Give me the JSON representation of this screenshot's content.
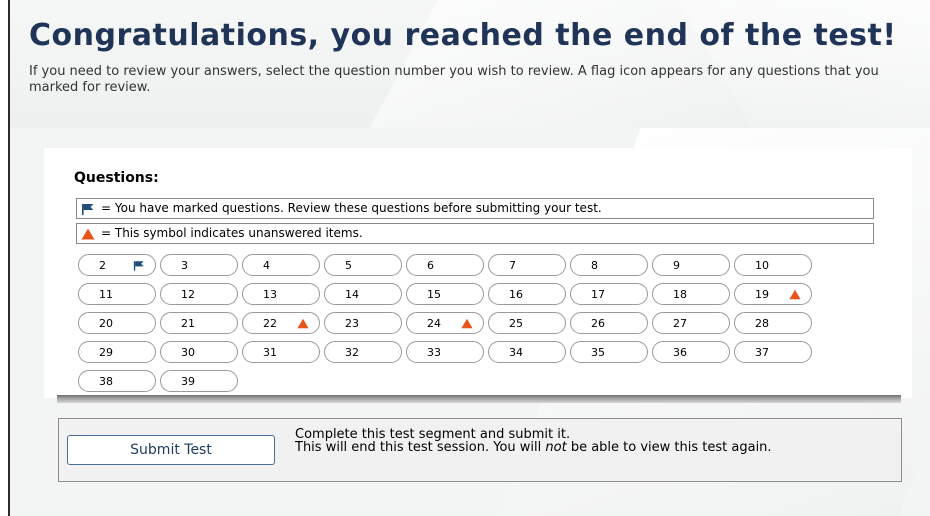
{
  "header": {
    "title": "Congratulations, you reached the end of the test!",
    "subtitle": "If you need to review your answers, select the question number you wish to review. A flag icon appears for any questions that you marked for review."
  },
  "panel": {
    "heading": "Questions:",
    "legend": {
      "flag_icon": "flag-icon",
      "flag_text": "= You have marked questions. Review these questions before submitting your test.",
      "unanswered_icon": "warning-triangle-icon",
      "unanswered_text": "= This symbol indicates unanswered items."
    }
  },
  "questions": [
    {
      "num": "2",
      "marked": true,
      "unanswered": false
    },
    {
      "num": "3",
      "marked": false,
      "unanswered": false
    },
    {
      "num": "4",
      "marked": false,
      "unanswered": false
    },
    {
      "num": "5",
      "marked": false,
      "unanswered": false
    },
    {
      "num": "6",
      "marked": false,
      "unanswered": false
    },
    {
      "num": "7",
      "marked": false,
      "unanswered": false
    },
    {
      "num": "8",
      "marked": false,
      "unanswered": false
    },
    {
      "num": "9",
      "marked": false,
      "unanswered": false
    },
    {
      "num": "10",
      "marked": false,
      "unanswered": false
    },
    {
      "num": "11",
      "marked": false,
      "unanswered": false
    },
    {
      "num": "12",
      "marked": false,
      "unanswered": false
    },
    {
      "num": "13",
      "marked": false,
      "unanswered": false
    },
    {
      "num": "14",
      "marked": false,
      "unanswered": false
    },
    {
      "num": "15",
      "marked": false,
      "unanswered": false
    },
    {
      "num": "16",
      "marked": false,
      "unanswered": false
    },
    {
      "num": "17",
      "marked": false,
      "unanswered": false
    },
    {
      "num": "18",
      "marked": false,
      "unanswered": false
    },
    {
      "num": "19",
      "marked": false,
      "unanswered": true
    },
    {
      "num": "20",
      "marked": false,
      "unanswered": false
    },
    {
      "num": "21",
      "marked": false,
      "unanswered": false
    },
    {
      "num": "22",
      "marked": false,
      "unanswered": true
    },
    {
      "num": "23",
      "marked": false,
      "unanswered": false
    },
    {
      "num": "24",
      "marked": false,
      "unanswered": true
    },
    {
      "num": "25",
      "marked": false,
      "unanswered": false
    },
    {
      "num": "26",
      "marked": false,
      "unanswered": false
    },
    {
      "num": "27",
      "marked": false,
      "unanswered": false
    },
    {
      "num": "28",
      "marked": false,
      "unanswered": false
    },
    {
      "num": "29",
      "marked": false,
      "unanswered": false
    },
    {
      "num": "30",
      "marked": false,
      "unanswered": false
    },
    {
      "num": "31",
      "marked": false,
      "unanswered": false
    },
    {
      "num": "32",
      "marked": false,
      "unanswered": false
    },
    {
      "num": "33",
      "marked": false,
      "unanswered": false
    },
    {
      "num": "34",
      "marked": false,
      "unanswered": false
    },
    {
      "num": "35",
      "marked": false,
      "unanswered": false
    },
    {
      "num": "36",
      "marked": false,
      "unanswered": false
    },
    {
      "num": "37",
      "marked": false,
      "unanswered": false
    },
    {
      "num": "38",
      "marked": false,
      "unanswered": false
    },
    {
      "num": "39",
      "marked": false,
      "unanswered": false
    }
  ],
  "submit": {
    "button_label": "Submit Test",
    "desc_line1": "Complete this test segment and submit it.",
    "desc_line2_pre": "This will end this test session. You will ",
    "desc_line2_em": "not",
    "desc_line2_post": " be able to view this test again."
  },
  "colors": {
    "title": "#1f3456",
    "flag": "#1f4e79",
    "warning": "#e8541a"
  }
}
